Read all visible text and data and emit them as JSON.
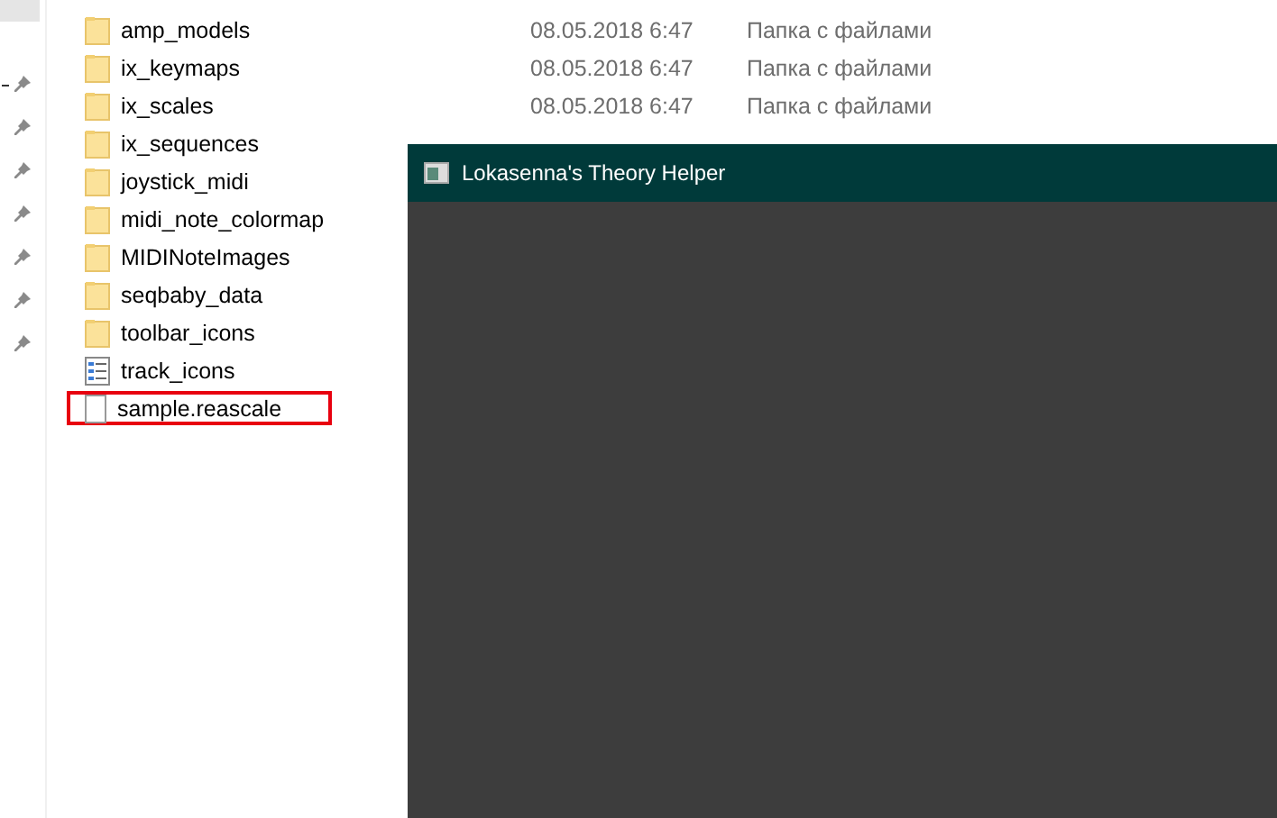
{
  "files": [
    {
      "name": "amp_models",
      "kind": "folder",
      "date": "08.05.2018 6:47",
      "type": "Папка с файлами",
      "highlighted": false
    },
    {
      "name": "ix_keymaps",
      "kind": "folder",
      "date": "08.05.2018 6:47",
      "type": "Папка с файлами",
      "highlighted": false
    },
    {
      "name": "ix_scales",
      "kind": "folder",
      "date": "08.05.2018 6:47",
      "type": "Папка с файлами",
      "highlighted": false
    },
    {
      "name": "ix_sequences",
      "kind": "folder",
      "highlighted": false
    },
    {
      "name": "joystick_midi",
      "kind": "folder",
      "highlighted": false
    },
    {
      "name": "midi_note_colormap",
      "kind": "folder",
      "highlighted": false
    },
    {
      "name": "MIDINoteImages",
      "kind": "folder",
      "highlighted": false
    },
    {
      "name": "seqbaby_data",
      "kind": "folder",
      "highlighted": false
    },
    {
      "name": "toolbar_icons",
      "kind": "folder",
      "highlighted": false
    },
    {
      "name": "track_icons",
      "kind": "list",
      "highlighted": false
    },
    {
      "name": "sample.reascale",
      "kind": "file",
      "highlighted": true
    }
  ],
  "window": {
    "title": "Lokasenna's Theory Helper"
  }
}
